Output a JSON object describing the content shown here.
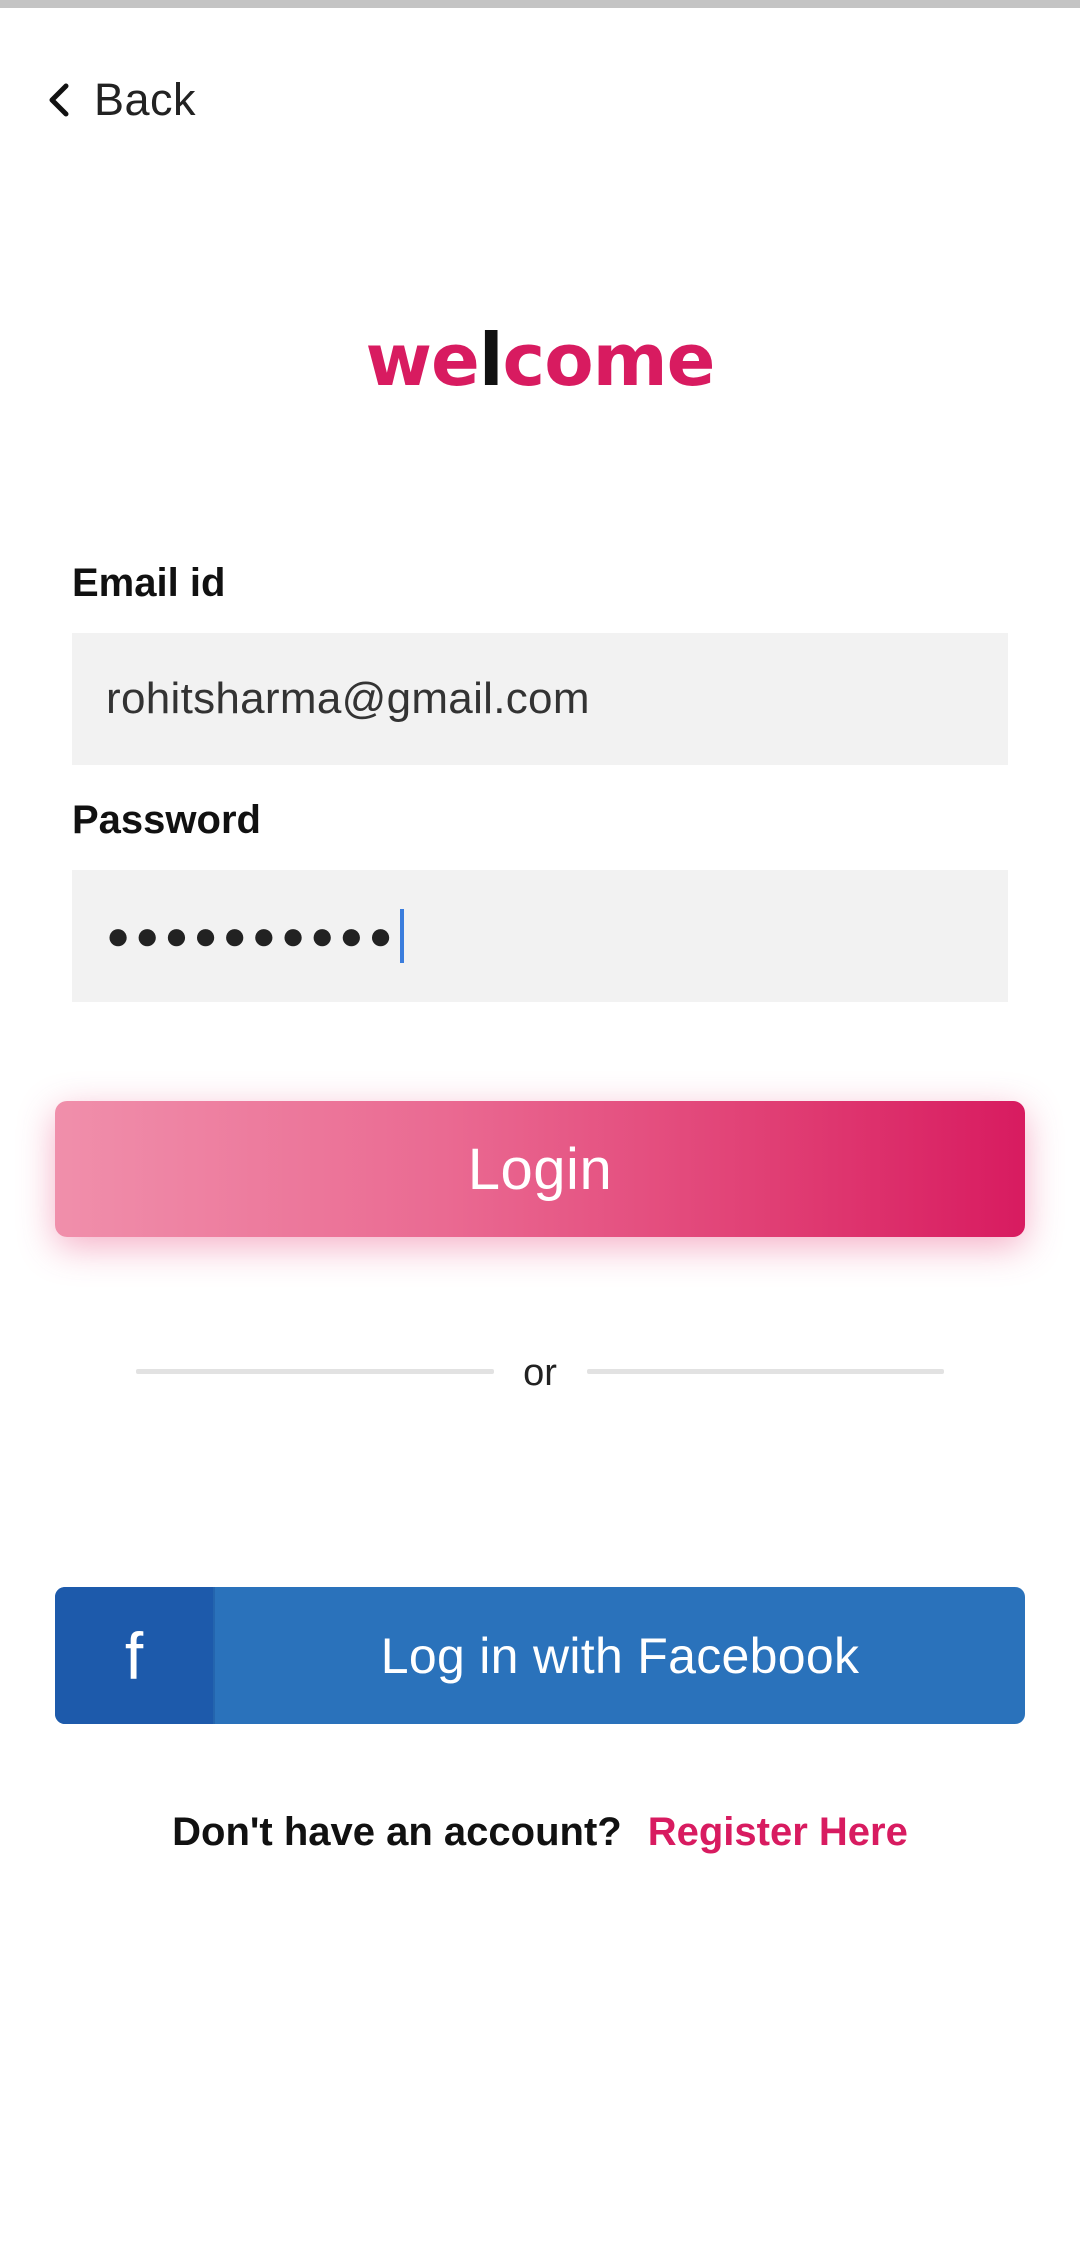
{
  "header": {
    "back_label": "Back"
  },
  "welcome": {
    "part1": "we",
    "part2": "l",
    "part3": "come"
  },
  "form": {
    "email_label": "Email id",
    "email_value": "rohitsharma@gmail.com",
    "password_label": "Password",
    "password_masked": "●●●●●●●●●●"
  },
  "actions": {
    "login_label": "Login",
    "divider_text": "or",
    "facebook_icon": "f",
    "facebook_label": "Log in with Facebook"
  },
  "footer": {
    "register_question": "Don't have an account?",
    "register_link": "Register Here"
  },
  "colors": {
    "brand_pink": "#d81b60",
    "facebook_blue": "#2a72bb",
    "facebook_dark": "#1d5aab",
    "field_bg": "#f2f2f2",
    "caret": "#3b7ddd"
  },
  "icons": {
    "back": "chevron-left-icon",
    "facebook": "facebook-icon"
  }
}
